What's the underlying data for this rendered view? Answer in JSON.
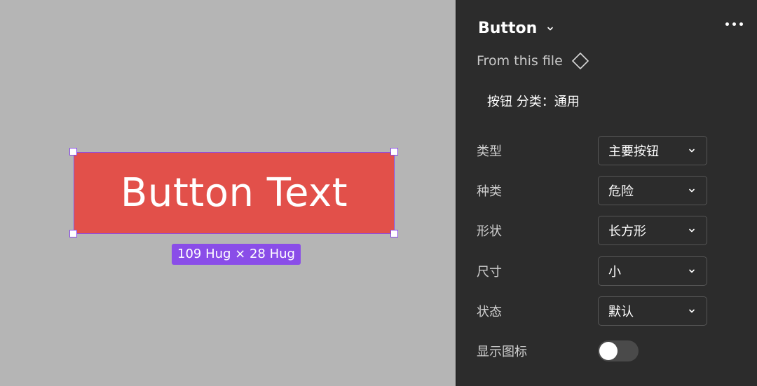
{
  "canvas": {
    "button_text": "Button Text",
    "size_label": "109 Hug × 28 Hug",
    "button_color": "#e2504a",
    "selection_color": "#8a4de8"
  },
  "panel": {
    "component_name": "Button",
    "source_label": "From this file",
    "category": "按钮 分类：通用",
    "properties": [
      {
        "label": "类型",
        "value": "主要按钮"
      },
      {
        "label": "种类",
        "value": "危险"
      },
      {
        "label": "形状",
        "value": "长方形"
      },
      {
        "label": "尺寸",
        "value": "小"
      },
      {
        "label": "状态",
        "value": "默认"
      }
    ],
    "toggle": {
      "label": "显示图标",
      "on": false
    }
  }
}
